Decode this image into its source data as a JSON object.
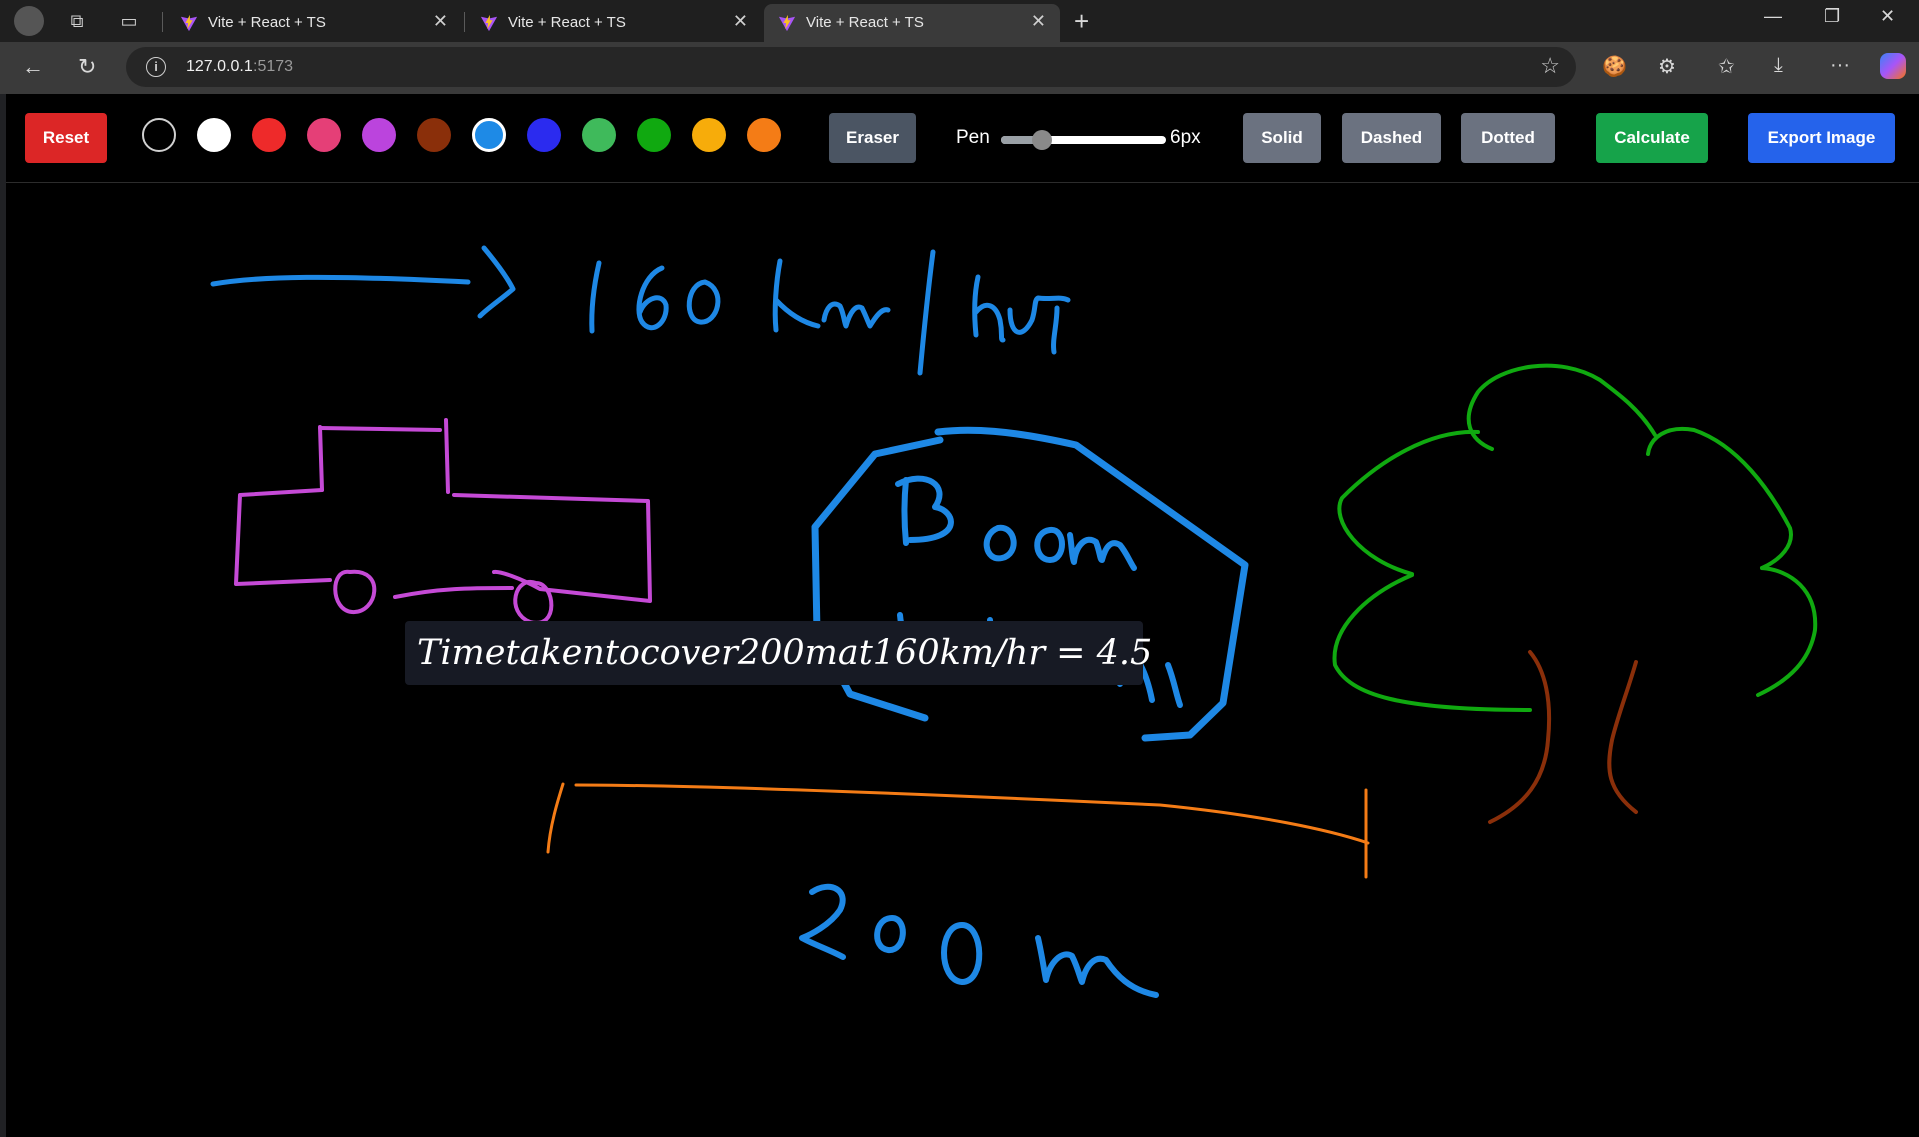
{
  "browser": {
    "tabs": [
      {
        "title": "Vite + React + TS",
        "active": false
      },
      {
        "title": "Vite + React + TS",
        "active": false
      },
      {
        "title": "Vite + React + TS",
        "active": true
      }
    ],
    "url_host": "127.0.0.1",
    "url_port": ":5173"
  },
  "app": {
    "reset_label": "Reset",
    "colors": [
      "#000000",
      "#ffffff",
      "#ee2a2a",
      "#e53f77",
      "#bb44dd",
      "#8a2f0a",
      "#1e8ae6",
      "#2b2bef",
      "#3fba5b",
      "#10a910",
      "#f7ac0a",
      "#f47c16"
    ],
    "selected_color": "#1e8ae6",
    "eraser_label": "Eraser",
    "pen_label": "Pen",
    "pen_size_label": "6px",
    "pen_size_fraction": 0.25,
    "style_buttons": [
      "Solid",
      "Dashed",
      "Dotted"
    ],
    "calculate_label": "Calculate",
    "export_label": "Export Image",
    "result_text": "Timetakentocover200mat160km/hr = 4.5"
  }
}
